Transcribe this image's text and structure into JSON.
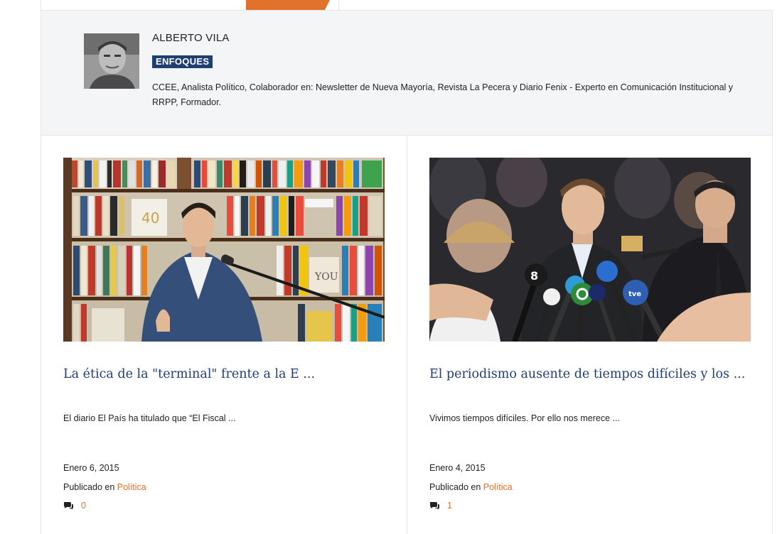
{
  "author": {
    "name": "ALBERTO VILA",
    "section_badge": "ENFOQUES",
    "bio": "CCEE, Analista Político, Colaborador en: Newsletter de Nueva Mayoría, Revista La Pecera y Diario Fenix - Experto en Comunicación Institucional y RRPP, Formador."
  },
  "posts": [
    {
      "title": "La ética de la \"terminal\" frente a la E ...",
      "excerpt": "El diario El País ha titulado que “El Fiscal ...",
      "date": "Enero 6, 2015",
      "published_label": "Publicado en",
      "category": "Política",
      "comments": "0"
    },
    {
      "title": "El periodismo ausente de tiempos difíciles y los ...",
      "excerpt": "Vivimos tiempos difíciles. Por ello nos merece ...",
      "date": "Enero 4, 2015",
      "published_label": "Publicado en",
      "category": "Política",
      "comments": "1"
    }
  ],
  "colors": {
    "accent": "#e0722b",
    "title_blue": "#1f3f73",
    "panel_bg": "#f4f5f7"
  },
  "icons": {
    "comment": "comments-icon"
  }
}
